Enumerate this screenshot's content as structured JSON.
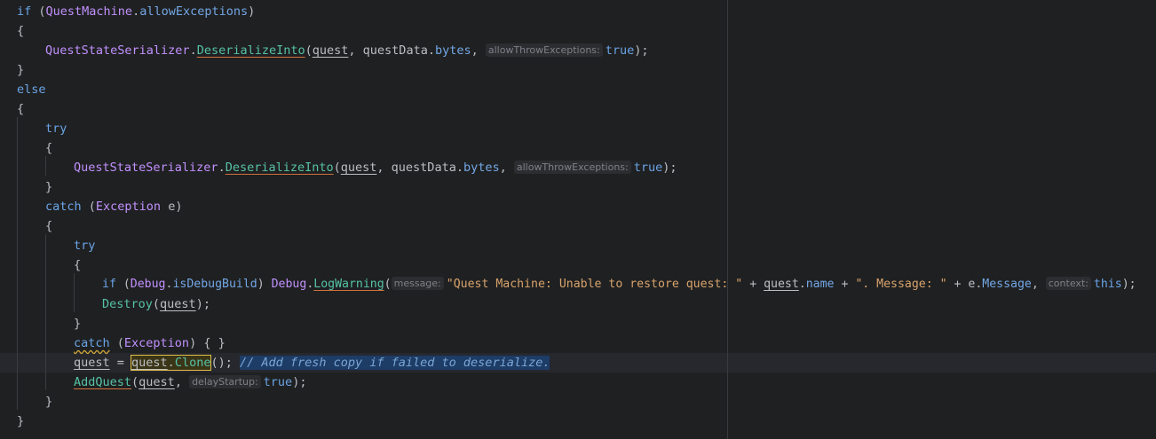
{
  "code": {
    "if_kw": "if",
    "quest_machine": "QuestMachine",
    "allow_exceptions": "allowExceptions",
    "open_brace": "{",
    "close_brace": "}",
    "serializer": "QuestStateSerializer",
    "deserialize_into": "DeserializeInto",
    "quest_var": "quest",
    "quest_data": "questData",
    "bytes_prop": "bytes",
    "hint_allow_throw": "allowThrowExceptions:",
    "true_kw": "true",
    "else_kw": "else",
    "try_kw": "try",
    "catch_kw": "catch",
    "exception_type": "Exception",
    "e_var": "e",
    "debug_class": "Debug",
    "is_debug_build": "isDebugBuild",
    "log_warning": "LogWarning",
    "hint_message": "message:",
    "str_unable": "\"Quest Machine: Unable to restore quest: \"",
    "name_prop": "name",
    "str_message": "\". Message: \"",
    "message_prop": "Message",
    "hint_context": "context:",
    "this_kw": "this",
    "destroy_fn": "Destroy",
    "clone_fn": "Clone",
    "comment_text": "// Add fresh copy if failed to deserialize.",
    "add_quest_fn": "AddQuest",
    "hint_delay_startup": "delayStartup:"
  }
}
